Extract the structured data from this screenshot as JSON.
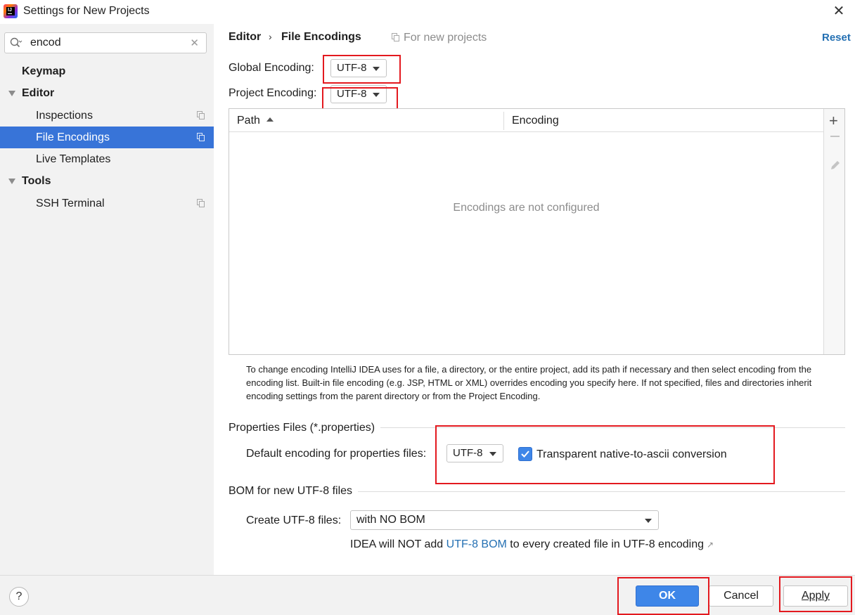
{
  "window": {
    "title": "Settings for New Projects",
    "app_icon": "intellij-idea-icon",
    "app_icon_text": "IJ"
  },
  "sidebar": {
    "search": {
      "value": "encod",
      "placeholder": ""
    },
    "items": [
      {
        "label": "Keymap",
        "bold": true
      },
      {
        "label": "Editor",
        "bold": true,
        "expanded": true
      },
      {
        "label": "Inspections",
        "indent": true
      },
      {
        "label": "File Encodings",
        "indent": true,
        "selected": true
      },
      {
        "label": "Live Templates",
        "indent": true
      },
      {
        "label": "Tools",
        "bold": true,
        "expanded": true
      },
      {
        "label": "SSH Terminal",
        "indent": true
      }
    ]
  },
  "header": {
    "breadcrumb": [
      "Editor",
      "File Encodings"
    ],
    "separator": "›",
    "scope": "For new projects",
    "reset": "Reset"
  },
  "encodings": {
    "global_label": "Global Encoding:",
    "global_value": "UTF-8",
    "project_label": "Project Encoding:",
    "project_value": "UTF-8"
  },
  "table": {
    "columns": [
      "Path",
      "Encoding"
    ],
    "empty_text": "Encodings are not configured",
    "rows": []
  },
  "help_text": "To change encoding IntelliJ IDEA uses for a file, a directory, or the entire project, add its path if necessary and then select encoding from the encoding list. Built-in file encoding (e.g. JSP, HTML or XML) overrides encoding you specify here. If not specified, files and directories inherit encoding settings from the parent directory or from the Project Encoding.",
  "properties": {
    "section": "Properties Files (*.properties)",
    "default_label": "Default encoding for properties files:",
    "default_value": "UTF-8",
    "transparent_label": "Transparent native-to-ascii conversion",
    "transparent_checked": true
  },
  "bom": {
    "section": "BOM for new UTF-8 files",
    "create_label": "Create UTF-8 files:",
    "create_value": "with NO BOM",
    "note_prefix": "IDEA will NOT add ",
    "note_link": "UTF-8 BOM",
    "note_suffix": " to every created file in UTF-8 encoding",
    "note_arrow": "↗"
  },
  "footer": {
    "help": "?",
    "ok": "OK",
    "cancel": "Cancel",
    "apply": "Apply"
  },
  "colors": {
    "accent": "#3874d8",
    "button_primary": "#3e86e8",
    "link": "#2470b3",
    "highlight_box": "#e3191f"
  }
}
